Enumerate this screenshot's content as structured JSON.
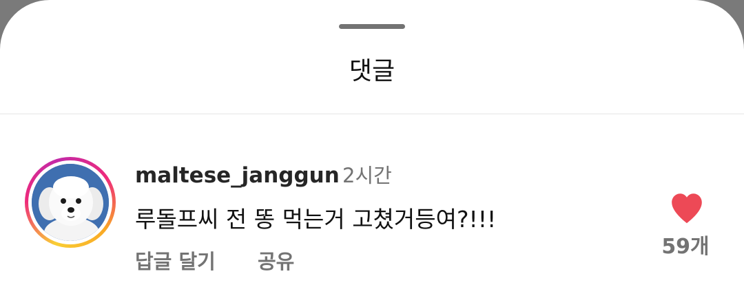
{
  "sheet": {
    "title": "댓글"
  },
  "comment": {
    "username": "maltese_janggun",
    "timestamp": "2시간",
    "text": "루돌프씨 전 똥 먹는거 고쳤거등여?!!!",
    "reply_label": "답글 달기",
    "share_label": "공유",
    "like_count": "59개",
    "liked": true,
    "avatar_icon": "white-maltese-dog-avatar",
    "like_icon": "heart-filled-icon"
  },
  "colors": {
    "like_red": "#ed4956",
    "avatar_background": "#3f6fb0",
    "secondary_text": "#737373",
    "primary_text": "#111111"
  }
}
